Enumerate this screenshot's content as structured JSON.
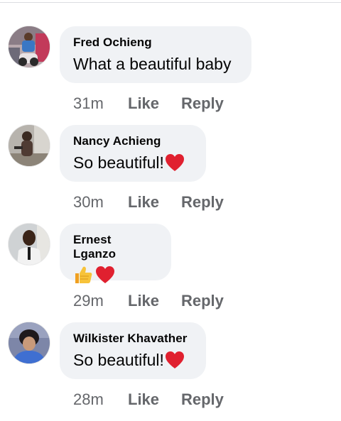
{
  "comments": [
    {
      "author": "Fred Ochieng",
      "text": "What a beautiful baby",
      "time": "31m",
      "like": "Like",
      "reply": "Reply",
      "emoji": []
    },
    {
      "author": "Nancy Achieng",
      "text": "So beautiful!",
      "time": "30m",
      "like": "Like",
      "reply": "Reply",
      "emoji": [
        "red-heart"
      ]
    },
    {
      "author": "Ernest Lganzo",
      "text": "",
      "time": "29m",
      "like": "Like",
      "reply": "Reply",
      "emoji": [
        "thumbs-up",
        "red-heart"
      ]
    },
    {
      "author": "Wilkister Khavather",
      "text": "So beautiful!",
      "time": "28m",
      "like": "Like",
      "reply": "Reply",
      "emoji": [
        "red-heart"
      ]
    }
  ],
  "colors": {
    "bubble": "#f0f2f5",
    "name": "#050505",
    "meta": "#65676b",
    "heart": "#e0202f",
    "thumb": "#f7c33a"
  }
}
